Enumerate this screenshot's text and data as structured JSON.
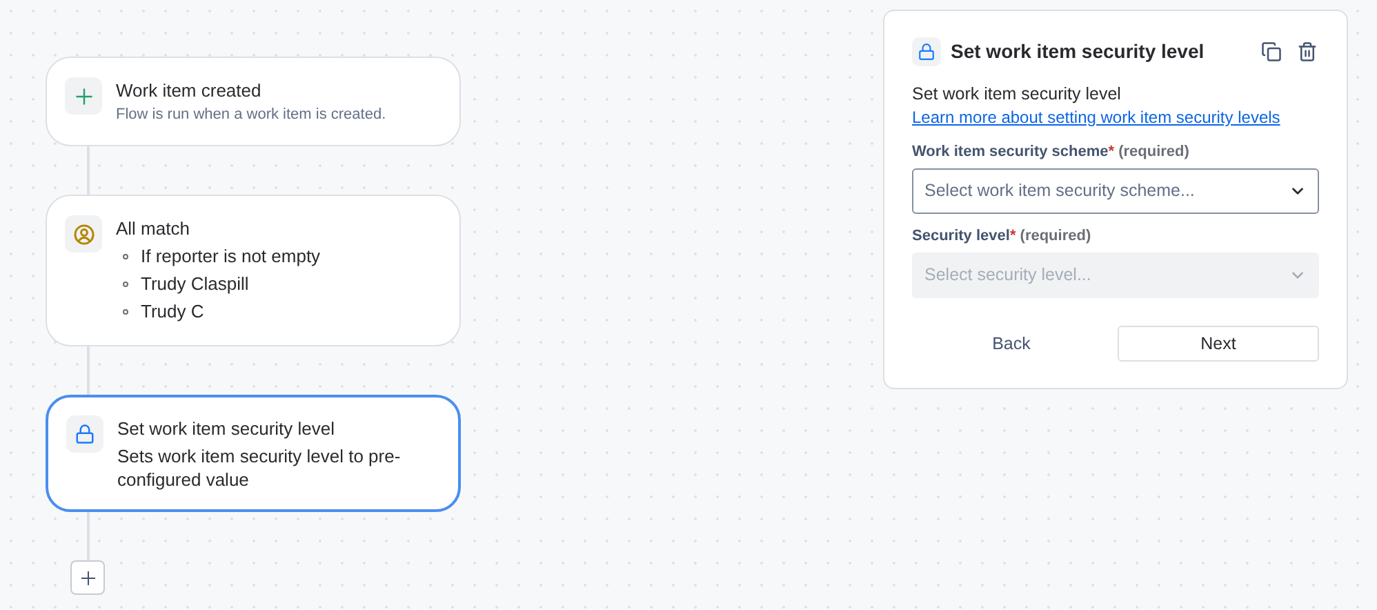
{
  "flow": {
    "nodes": [
      {
        "kind": "trigger",
        "title": "Work item created",
        "description": "Flow is run when a work item is created.",
        "selected": false
      },
      {
        "kind": "condition",
        "title": "All match",
        "items": [
          "If reporter is not empty",
          "Trudy Claspill",
          "Trudy C"
        ],
        "selected": false
      },
      {
        "kind": "action",
        "title": "Set work item security level",
        "description": "Sets work item security level to pre-configured value",
        "selected": true
      }
    ]
  },
  "panel": {
    "title": "Set work item security level",
    "intro": "Set work item security level",
    "link": "Learn more about setting work item security levels",
    "fields": [
      {
        "label": "Work item security scheme",
        "required_mark": "*",
        "required_text": "(required)",
        "placeholder": "Select work item security scheme...",
        "disabled": false
      },
      {
        "label": "Security level",
        "required_mark": "*",
        "required_text": "(required)",
        "placeholder": "Select security level...",
        "disabled": true
      }
    ],
    "buttons": [
      "Back",
      "Next"
    ]
  }
}
